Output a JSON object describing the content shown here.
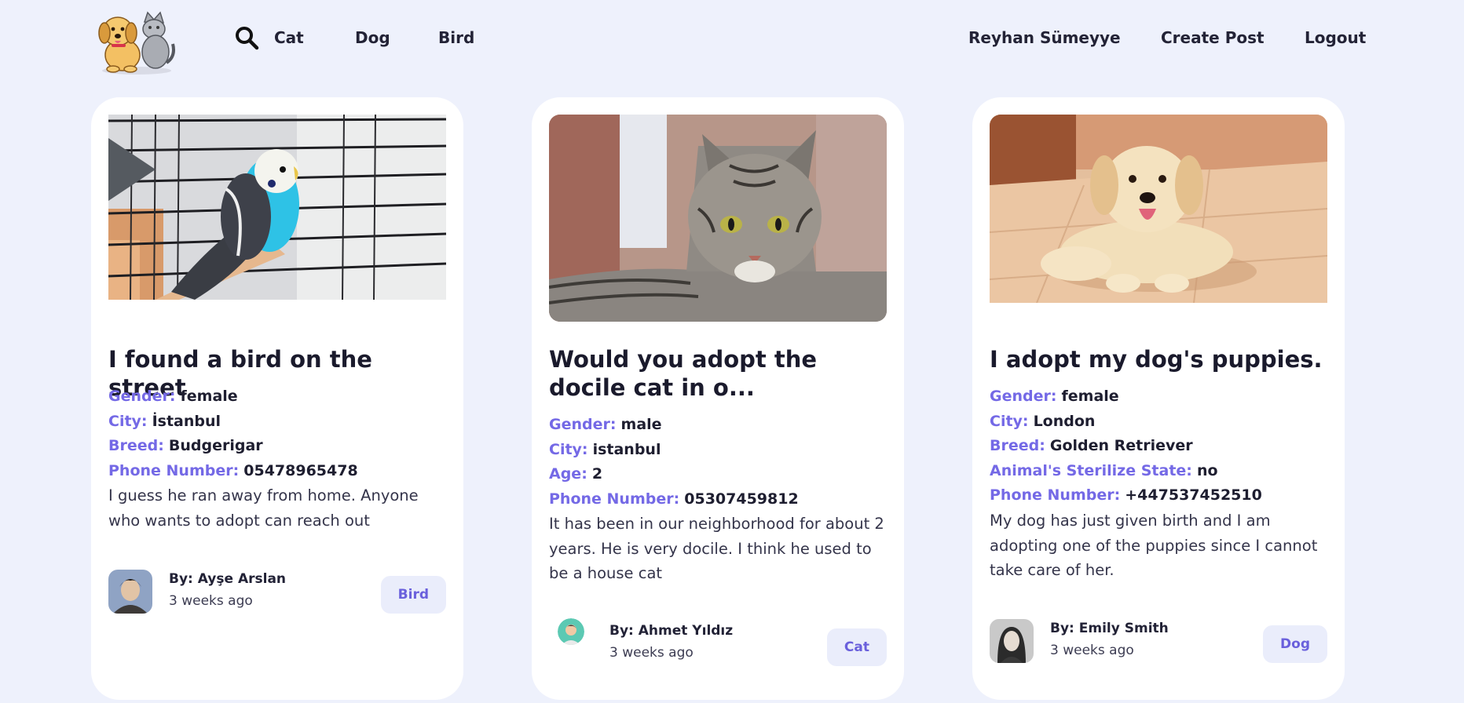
{
  "nav": {
    "links": [
      "Cat",
      "Dog",
      "Bird"
    ],
    "user_name": "Reyhan Sümeyye",
    "create_post": "Create Post",
    "logout": "Logout"
  },
  "colors": {
    "background": "#eef1fc",
    "accent": "#7469e6",
    "tag_bg": "#eaedfb"
  },
  "posts": [
    {
      "title": "I found a bird on the street",
      "image_subject": "budgerigar",
      "fields": [
        {
          "label": "Gender:",
          "value": "female"
        },
        {
          "label": "City:",
          "value": "İstanbul"
        },
        {
          "label": "Breed:",
          "value": "Budgerigar"
        },
        {
          "label": "Phone Number:",
          "value": "05478965478"
        }
      ],
      "description": "I guess he ran away from home. Anyone who wants to adopt can reach out",
      "author": "By: Ayşe Arslan",
      "time": "3 weeks ago",
      "tag": "Bird"
    },
    {
      "title": "Would you adopt the docile cat in o...",
      "image_subject": "tabby-cat",
      "fields": [
        {
          "label": "Gender:",
          "value": "male"
        },
        {
          "label": "City:",
          "value": "istanbul"
        },
        {
          "label": "Age:",
          "value": "2"
        },
        {
          "label": "Phone Number:",
          "value": "05307459812"
        }
      ],
      "description": "It has been in our neighborhood for about 2 years. He is very docile. I think he used to be a house cat",
      "author": "By: Ahmet Yıldız",
      "time": "3 weeks ago",
      "tag": "Cat"
    },
    {
      "title": "I adopt my dog's puppies.",
      "image_subject": "golden-retriever-puppy",
      "fields": [
        {
          "label": "Gender:",
          "value": "female"
        },
        {
          "label": "City:",
          "value": "London"
        },
        {
          "label": "Breed:",
          "value": "Golden Retriever"
        },
        {
          "label": "Animal's Sterilize State:",
          "value": "no"
        },
        {
          "label": "Phone Number:",
          "value": "+447537452510"
        }
      ],
      "description": "My dog has just given birth and I am adopting one of the puppies since I cannot take care of her.",
      "author": "By: Emily Smith",
      "time": "3 weeks ago",
      "tag": "Dog"
    }
  ]
}
